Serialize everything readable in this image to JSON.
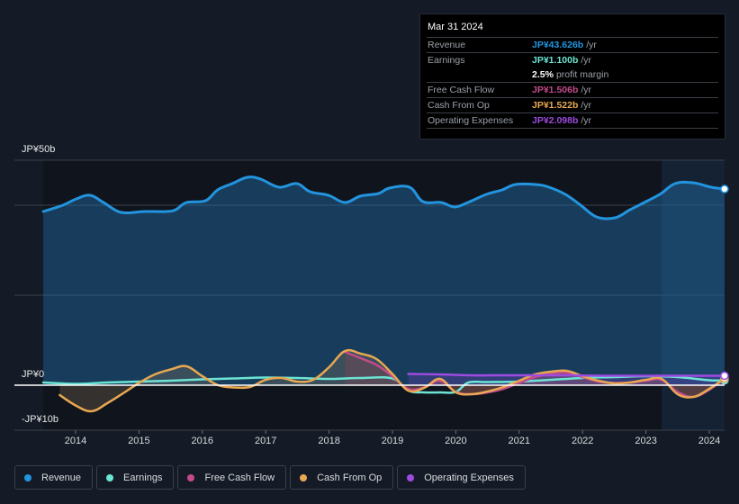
{
  "tooltip": {
    "date": "Mar 31 2024",
    "rows": [
      {
        "label": "Revenue",
        "value": "JP¥43.626b",
        "unit": "/yr",
        "color": "#2394df"
      },
      {
        "label": "Earnings",
        "value": "JP¥1.100b",
        "unit": "/yr",
        "color": "#6ce5d4"
      },
      {
        "label": "",
        "value": "2.5%",
        "unit": "profit margin",
        "color": "#ffffff"
      },
      {
        "label": "Free Cash Flow",
        "value": "JP¥1.506b",
        "unit": "/yr",
        "color": "#c34b8b"
      },
      {
        "label": "Cash From Op",
        "value": "JP¥1.522b",
        "unit": "/yr",
        "color": "#e8a851"
      },
      {
        "label": "Operating Expenses",
        "value": "JP¥2.098b",
        "unit": "/yr",
        "color": "#9d4be0"
      }
    ]
  },
  "legend": [
    {
      "label": "Revenue",
      "color": "#2394df"
    },
    {
      "label": "Earnings",
      "color": "#6ce5d4"
    },
    {
      "label": "Free Cash Flow",
      "color": "#c34b8b"
    },
    {
      "label": "Cash From Op",
      "color": "#e8a851"
    },
    {
      "label": "Operating Expenses",
      "color": "#9d4be0"
    }
  ],
  "chart_data": {
    "type": "area",
    "title": "",
    "xlabel": "",
    "ylabel": "",
    "y_tick_labels": [
      "JP¥50b",
      "JP¥0",
      "-JP¥10b"
    ],
    "y_ticks": [
      50,
      0,
      -10
    ],
    "gridlines_at": [
      50,
      40,
      20,
      0
    ],
    "ylim": [
      -10,
      50
    ],
    "xlim": [
      2013.49,
      2024.25
    ],
    "x_tick_labels": [
      "2014",
      "2015",
      "2016",
      "2017",
      "2018",
      "2019",
      "2020",
      "2021",
      "2022",
      "2023",
      "2024"
    ],
    "x_ticks": [
      2014,
      2015,
      2016,
      2017,
      2018,
      2019,
      2020,
      2021,
      2022,
      2023,
      2024
    ],
    "highlight_range": [
      2023.25,
      2024.25
    ],
    "series": [
      {
        "name": "Revenue",
        "color": "#2394df",
        "fill": true,
        "x": [
          2013.49,
          2013.8,
          2014.01,
          2014.23,
          2014.44,
          2014.72,
          2015.08,
          2015.43,
          2015.58,
          2015.75,
          2016.05,
          2016.24,
          2016.47,
          2016.71,
          2016.92,
          2017.21,
          2017.49,
          2017.7,
          2017.99,
          2018.25,
          2018.49,
          2018.78,
          2018.95,
          2019.27,
          2019.48,
          2019.77,
          2019.98,
          2020.19,
          2020.48,
          2020.73,
          2020.94,
          2021.26,
          2021.47,
          2021.73,
          2021.97,
          2022.22,
          2022.51,
          2022.75,
          2023.03,
          2023.24,
          2023.46,
          2023.74,
          2024.03,
          2024.24
        ],
        "values": [
          38.6,
          40.0,
          41.4,
          42.2,
          40.6,
          38.4,
          38.6,
          38.6,
          39.0,
          40.6,
          41.0,
          43.4,
          44.8,
          46.2,
          45.8,
          44.0,
          44.8,
          43.0,
          42.2,
          40.6,
          42.0,
          42.6,
          43.8,
          44.0,
          40.8,
          40.6,
          39.6,
          40.6,
          42.4,
          43.4,
          44.6,
          44.6,
          44.0,
          42.4,
          40.0,
          37.4,
          37.2,
          39.0,
          41.0,
          42.6,
          44.8,
          45.0,
          44.0,
          43.6
        ]
      },
      {
        "name": "Earnings",
        "color": "#6ce5d4",
        "fill": false,
        "x": [
          2013.49,
          2014.0,
          2014.5,
          2015.0,
          2015.5,
          2016.0,
          2016.5,
          2017.0,
          2017.5,
          2018.0,
          2018.5,
          2019.0,
          2019.25,
          2019.5,
          2019.75,
          2020.0,
          2020.2,
          2020.5,
          2021.0,
          2021.5,
          2022.0,
          2022.5,
          2023.0,
          2023.5,
          2024.0,
          2024.24
        ],
        "values": [
          0.6,
          0.3,
          0.6,
          0.8,
          1.0,
          1.3,
          1.5,
          1.7,
          1.6,
          1.4,
          1.6,
          1.5,
          -1.2,
          -1.6,
          -1.6,
          -1.5,
          0.6,
          0.7,
          0.8,
          1.2,
          1.6,
          1.8,
          2.0,
          1.8,
          1.1,
          1.1
        ]
      },
      {
        "name": "Free Cash Flow",
        "color": "#c34b8b",
        "fill": true,
        "x": [
          2018.25,
          2018.5,
          2018.75,
          2019.0,
          2019.25,
          2019.5,
          2019.75,
          2020.0,
          2020.25,
          2020.5,
          2020.75,
          2021.0,
          2021.25,
          2021.5,
          2021.75,
          2022.0,
          2022.25,
          2022.5,
          2022.75,
          2023.0,
          2023.25,
          2023.5,
          2023.75,
          2024.0,
          2024.24
        ],
        "values": [
          7.4,
          6.0,
          4.5,
          2.0,
          -0.8,
          -0.5,
          1.0,
          -1.5,
          -2.0,
          -1.6,
          -0.8,
          0.5,
          1.8,
          2.5,
          2.8,
          1.8,
          0.8,
          0.5,
          0.6,
          1.0,
          1.2,
          -1.5,
          -2.6,
          -1.0,
          1.5
        ]
      },
      {
        "name": "Cash From Op",
        "color": "#e8a851",
        "fill": true,
        "x": [
          2013.75,
          2014.0,
          2014.25,
          2014.5,
          2014.75,
          2015.0,
          2015.25,
          2015.5,
          2015.75,
          2016.0,
          2016.25,
          2016.5,
          2016.75,
          2017.0,
          2017.25,
          2017.5,
          2017.75,
          2018.0,
          2018.25,
          2018.5,
          2018.75,
          2019.0,
          2019.25,
          2019.5,
          2019.75,
          2020.0,
          2020.25,
          2020.5,
          2020.75,
          2021.0,
          2021.25,
          2021.5,
          2021.75,
          2022.0,
          2022.25,
          2022.5,
          2022.75,
          2023.0,
          2023.25,
          2023.5,
          2023.75,
          2024.0,
          2024.24
        ],
        "values": [
          -2.2,
          -4.5,
          -5.8,
          -4.0,
          -1.8,
          0.5,
          2.4,
          3.5,
          4.2,
          2.0,
          0.0,
          -0.5,
          -0.4,
          1.2,
          1.6,
          0.8,
          1.2,
          4.0,
          7.6,
          7.0,
          5.8,
          2.5,
          -1.2,
          -0.6,
          1.4,
          -1.6,
          -2.0,
          -1.4,
          -0.4,
          1.0,
          2.4,
          3.0,
          3.2,
          2.0,
          1.0,
          0.4,
          0.6,
          1.2,
          1.4,
          -2.0,
          -2.6,
          -0.8,
          1.5
        ]
      },
      {
        "name": "Operating Expenses",
        "color": "#9d4be0",
        "fill": true,
        "x": [
          2019.25,
          2019.75,
          2020.25,
          2020.75,
          2021.25,
          2021.75,
          2022.25,
          2022.75,
          2023.25,
          2023.75,
          2024.24
        ],
        "values": [
          2.5,
          2.4,
          2.2,
          2.2,
          2.2,
          2.2,
          2.1,
          2.1,
          2.1,
          2.1,
          2.1
        ]
      }
    ]
  }
}
